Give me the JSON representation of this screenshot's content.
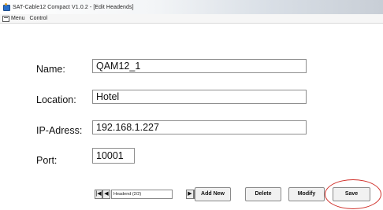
{
  "window": {
    "title": "SAT-Cable12 Compact V1.0.2 - [Edit Headends]"
  },
  "menubar": {
    "items": [
      {
        "label": "Menu"
      },
      {
        "label": "Control"
      }
    ]
  },
  "form": {
    "name": {
      "label": "Name:",
      "value": "QAM12_1"
    },
    "location": {
      "label": "Location:",
      "value": "Hotel"
    },
    "ip": {
      "label": "IP-Adress:",
      "value": "192.168.1.227"
    },
    "port": {
      "label": "Port:",
      "value": "10001"
    }
  },
  "navigator": {
    "position_text": "Headend (2/2)",
    "first_glyph": "|◀",
    "prev_glyph": "◀",
    "next_glyph": "▶",
    "last_glyph": "▶|"
  },
  "buttons": {
    "add_new": "Add New",
    "delete": "Delete",
    "modify": "Modify",
    "save": "Save"
  },
  "annotation": {
    "highlight_color": "#d0302a",
    "highlighted_target": "save-button"
  }
}
